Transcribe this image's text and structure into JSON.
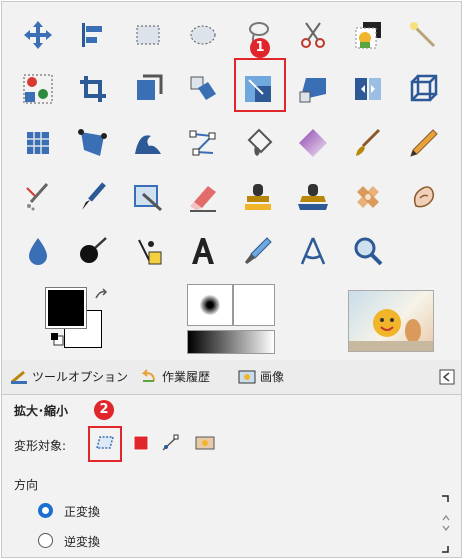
{
  "tools": [
    "move-tool",
    "align-tool",
    "rect-select-tool",
    "ellipse-select-tool",
    "free-select-tool",
    "scissors-select-tool",
    "foreground-select-tool",
    "fuzzy-select-tool",
    "select-by-color-tool",
    "crop-tool",
    "rotate-tool",
    "scale-tool",
    "shear-tool",
    "perspective-tool",
    "flip-tool",
    "cage-transform-tool",
    "unified-transform-tool",
    "handle-transform-tool",
    "warp-tool",
    "paths-tool",
    "bucket-fill-tool",
    "blend-tool",
    "paintbrush-tool",
    "pencil-tool",
    "airbrush-tool",
    "ink-tool",
    "mypaint-brush-tool",
    "eraser-tool",
    "clone-tool",
    "perspective-clone-tool",
    "heal-tool",
    "smudge-tool",
    "blur-sharpen-tool",
    "dodge-burn-tool",
    "text-select-tool",
    "text-tool",
    "color-picker-tool",
    "measure-tool",
    "zoom-tool"
  ],
  "annotations": {
    "badge1": "1",
    "badge2": "2"
  },
  "tabs": [
    {
      "label": "ツールオプション",
      "icon": "tool-options-icon"
    },
    {
      "label": "作業履歴",
      "icon": "undo-history-icon"
    },
    {
      "label": "画像",
      "icon": "images-icon"
    }
  ],
  "options": {
    "title": "拡大･縮小",
    "transform_label": "変形対象:",
    "direction_label": "方向",
    "direction_options": [
      {
        "label": "正変換",
        "selected": true
      },
      {
        "label": "逆変換",
        "selected": false
      }
    ]
  },
  "colors": {
    "highlight": "#e0262b",
    "radio_accent": "#1a6fd1"
  }
}
